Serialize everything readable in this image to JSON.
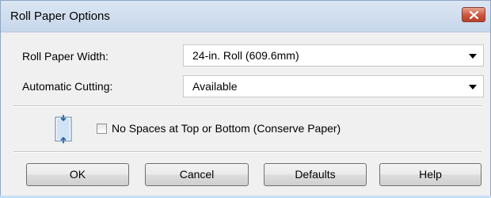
{
  "window": {
    "title": "Roll Paper Options"
  },
  "fields": {
    "roll_paper_width": {
      "label": "Roll Paper Width:",
      "value": "24-in. Roll (609.6mm)"
    },
    "automatic_cutting": {
      "label": "Automatic Cutting:",
      "value": "Available"
    }
  },
  "options": {
    "no_spaces": {
      "label": "No Spaces at Top or Bottom (Conserve Paper)",
      "checked": false
    }
  },
  "buttons": {
    "ok": "OK",
    "cancel": "Cancel",
    "defaults": "Defaults",
    "help": "Help"
  },
  "icons": {
    "close": "close-icon",
    "paper": "paper-margin-icon",
    "dropdown": "chevron-down-icon"
  },
  "colors": {
    "close_button": "#c9553c",
    "titlebar": "#c6d6ea"
  }
}
